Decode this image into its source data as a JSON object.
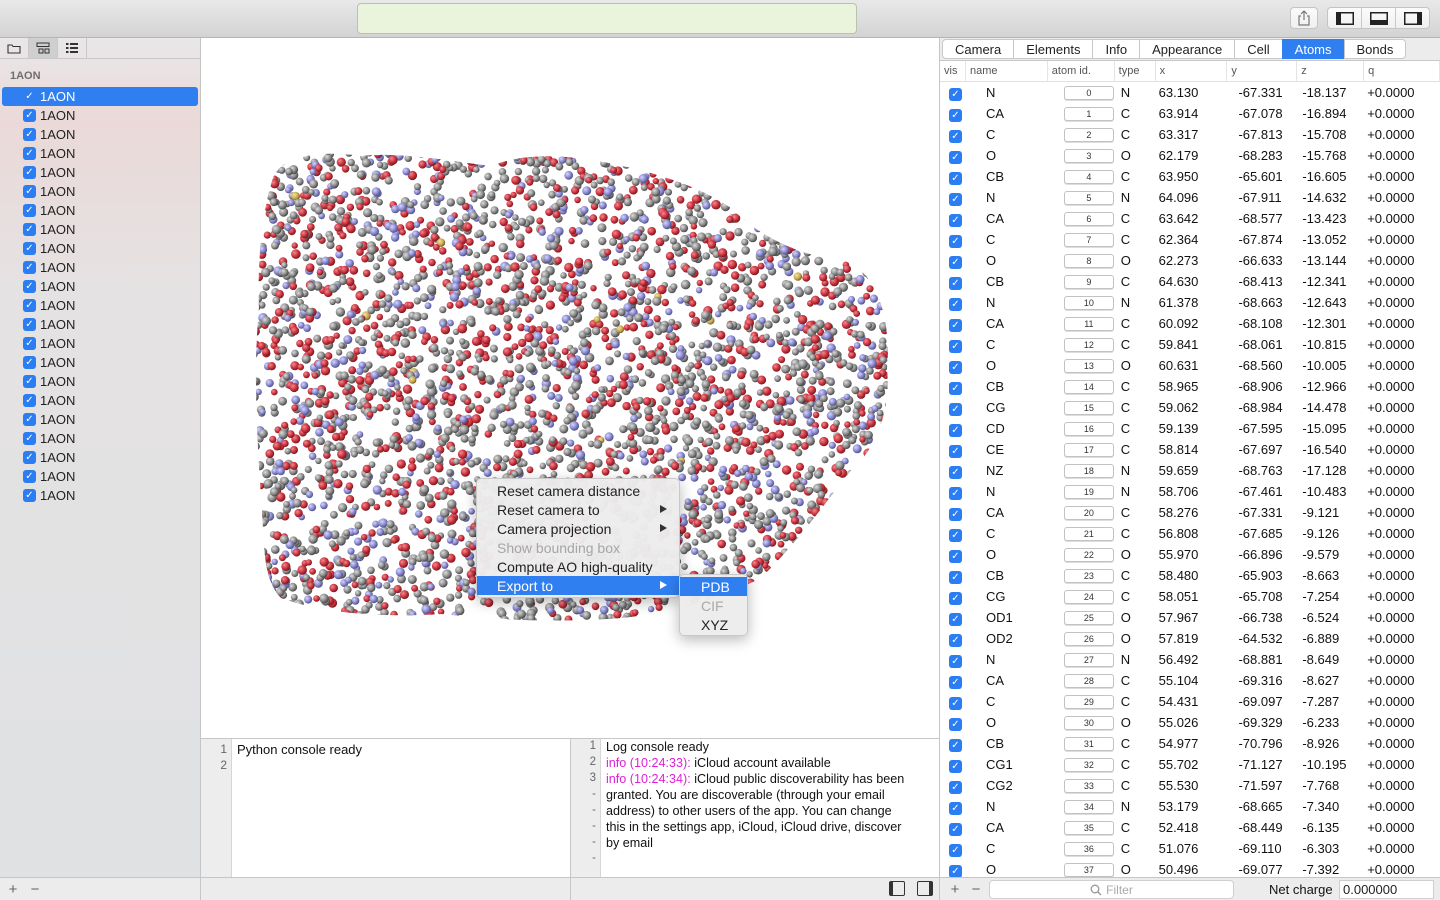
{
  "toolbar": {
    "address_text": ""
  },
  "sidebar": {
    "title": "1AON",
    "items": [
      {
        "label": "1AON"
      },
      {
        "label": "1AON"
      },
      {
        "label": "1AON"
      },
      {
        "label": "1AON"
      },
      {
        "label": "1AON"
      },
      {
        "label": "1AON"
      },
      {
        "label": "1AON"
      },
      {
        "label": "1AON"
      },
      {
        "label": "1AON"
      },
      {
        "label": "1AON"
      },
      {
        "label": "1AON"
      },
      {
        "label": "1AON"
      },
      {
        "label": "1AON"
      },
      {
        "label": "1AON"
      },
      {
        "label": "1AON"
      },
      {
        "label": "1AON"
      },
      {
        "label": "1AON"
      },
      {
        "label": "1AON"
      },
      {
        "label": "1AON"
      },
      {
        "label": "1AON"
      },
      {
        "label": "1AON"
      },
      {
        "label": "1AON"
      }
    ],
    "selected_index": 0,
    "footer": {
      "add": "+",
      "remove": "−"
    }
  },
  "colors": {
    "accent": "#2f7ff1",
    "atom_red": "#c8323c",
    "atom_gray": "#8c8c8c",
    "atom_blue": "#8a8ad0",
    "log_info": "#e020d8"
  },
  "context_menu": {
    "items": [
      {
        "label": "Reset camera distance",
        "disabled": false,
        "submenu": false
      },
      {
        "label": "Reset camera to",
        "disabled": false,
        "submenu": true
      },
      {
        "label": "Camera projection",
        "disabled": false,
        "submenu": true
      },
      {
        "label": "Show bounding box",
        "disabled": true,
        "submenu": false
      },
      {
        "label": "Compute AO high-quality",
        "disabled": false,
        "submenu": false
      },
      {
        "label": "Export to",
        "disabled": false,
        "submenu": true,
        "highlighted": true
      }
    ],
    "submenu": [
      {
        "label": "PDB",
        "highlighted": true
      },
      {
        "label": "CIF",
        "disabled": true
      },
      {
        "label": "XYZ"
      }
    ]
  },
  "python_console": {
    "line_numbers": [
      "1",
      "2"
    ],
    "lines": [
      "Python console ready"
    ]
  },
  "log_console": {
    "line_numbers": [
      "1",
      "2",
      "3",
      "-",
      "-",
      "-",
      "-",
      "-"
    ],
    "lines": [
      {
        "prefix": "",
        "text": "Log console ready"
      },
      {
        "prefix": "info (10:24:33):",
        "text": " iCloud account available"
      },
      {
        "prefix": "info (10:24:34):",
        "text": " iCloud public discoverability has been"
      },
      {
        "prefix": "",
        "text": "granted. You are discoverable (through your email"
      },
      {
        "prefix": "",
        "text": "address) to other users of the app. You can change"
      },
      {
        "prefix": "",
        "text": "this in the settings app, iCloud, iCloud drive, discover"
      },
      {
        "prefix": "",
        "text": "by email"
      }
    ]
  },
  "right_panel": {
    "tabs": [
      "Camera",
      "Elements",
      "Info",
      "Appearance",
      "Cell",
      "Atoms",
      "Bonds"
    ],
    "active_tab": "Atoms",
    "columns": [
      "vis",
      "name",
      "atom id.",
      "type",
      "x",
      "y",
      "z",
      "q"
    ],
    "rows": [
      [
        "N",
        "0",
        "N",
        "63.130",
        "-67.331",
        "-18.137",
        "+0.0000"
      ],
      [
        "CA",
        "1",
        "C",
        "63.914",
        "-67.078",
        "-16.894",
        "+0.0000"
      ],
      [
        "C",
        "2",
        "C",
        "63.317",
        "-67.813",
        "-15.708",
        "+0.0000"
      ],
      [
        "O",
        "3",
        "O",
        "62.179",
        "-68.283",
        "-15.768",
        "+0.0000"
      ],
      [
        "CB",
        "4",
        "C",
        "63.950",
        "-65.601",
        "-16.605",
        "+0.0000"
      ],
      [
        "N",
        "5",
        "N",
        "64.096",
        "-67.911",
        "-14.632",
        "+0.0000"
      ],
      [
        "CA",
        "6",
        "C",
        "63.642",
        "-68.577",
        "-13.423",
        "+0.0000"
      ],
      [
        "C",
        "7",
        "C",
        "62.364",
        "-67.874",
        "-13.052",
        "+0.0000"
      ],
      [
        "O",
        "8",
        "O",
        "62.273",
        "-66.633",
        "-13.144",
        "+0.0000"
      ],
      [
        "CB",
        "9",
        "C",
        "64.630",
        "-68.413",
        "-12.341",
        "+0.0000"
      ],
      [
        "N",
        "10",
        "N",
        "61.378",
        "-68.663",
        "-12.643",
        "+0.0000"
      ],
      [
        "CA",
        "11",
        "C",
        "60.092",
        "-68.108",
        "-12.301",
        "+0.0000"
      ],
      [
        "C",
        "12",
        "C",
        "59.841",
        "-68.061",
        "-10.815",
        "+0.0000"
      ],
      [
        "O",
        "13",
        "O",
        "60.631",
        "-68.560",
        "-10.005",
        "+0.0000"
      ],
      [
        "CB",
        "14",
        "C",
        "58.965",
        "-68.906",
        "-12.966",
        "+0.0000"
      ],
      [
        "CG",
        "15",
        "C",
        "59.062",
        "-68.984",
        "-14.478",
        "+0.0000"
      ],
      [
        "CD",
        "16",
        "C",
        "59.139",
        "-67.595",
        "-15.095",
        "+0.0000"
      ],
      [
        "CE",
        "17",
        "C",
        "58.814",
        "-67.697",
        "-16.540",
        "+0.0000"
      ],
      [
        "NZ",
        "18",
        "N",
        "59.659",
        "-68.763",
        "-17.128",
        "+0.0000"
      ],
      [
        "N",
        "19",
        "N",
        "58.706",
        "-67.461",
        "-10.483",
        "+0.0000"
      ],
      [
        "CA",
        "20",
        "C",
        "58.276",
        "-67.331",
        "-9.121",
        "+0.0000"
      ],
      [
        "C",
        "21",
        "C",
        "56.808",
        "-67.685",
        "-9.126",
        "+0.0000"
      ],
      [
        "O",
        "22",
        "O",
        "55.970",
        "-66.896",
        "-9.579",
        "+0.0000"
      ],
      [
        "CB",
        "23",
        "C",
        "58.480",
        "-65.903",
        "-8.663",
        "+0.0000"
      ],
      [
        "CG",
        "24",
        "C",
        "58.051",
        "-65.708",
        "-7.254",
        "+0.0000"
      ],
      [
        "OD1",
        "25",
        "O",
        "57.967",
        "-66.738",
        "-6.524",
        "+0.0000"
      ],
      [
        "OD2",
        "26",
        "O",
        "57.819",
        "-64.532",
        "-6.889",
        "+0.0000"
      ],
      [
        "N",
        "27",
        "N",
        "56.492",
        "-68.881",
        "-8.649",
        "+0.0000"
      ],
      [
        "CA",
        "28",
        "C",
        "55.104",
        "-69.316",
        "-8.627",
        "+0.0000"
      ],
      [
        "C",
        "29",
        "C",
        "54.431",
        "-69.097",
        "-7.287",
        "+0.0000"
      ],
      [
        "O",
        "30",
        "O",
        "55.026",
        "-69.329",
        "-6.233",
        "+0.0000"
      ],
      [
        "CB",
        "31",
        "C",
        "54.977",
        "-70.796",
        "-8.926",
        "+0.0000"
      ],
      [
        "CG1",
        "32",
        "C",
        "55.702",
        "-71.127",
        "-10.195",
        "+0.0000"
      ],
      [
        "CG2",
        "33",
        "C",
        "55.530",
        "-71.597",
        "-7.768",
        "+0.0000"
      ],
      [
        "N",
        "34",
        "N",
        "53.179",
        "-68.665",
        "-7.340",
        "+0.0000"
      ],
      [
        "CA",
        "35",
        "C",
        "52.418",
        "-68.449",
        "-6.135",
        "+0.0000"
      ],
      [
        "C",
        "36",
        "C",
        "51.076",
        "-69.110",
        "-6.303",
        "+0.0000"
      ],
      [
        "O",
        "37",
        "O",
        "50.496",
        "-69.077",
        "-7.392",
        "+0.0000"
      ]
    ],
    "footer": {
      "add": "+",
      "remove": "−",
      "filter_placeholder": "Filter",
      "net_charge_label": "Net charge",
      "net_charge_value": "0.000000"
    }
  }
}
